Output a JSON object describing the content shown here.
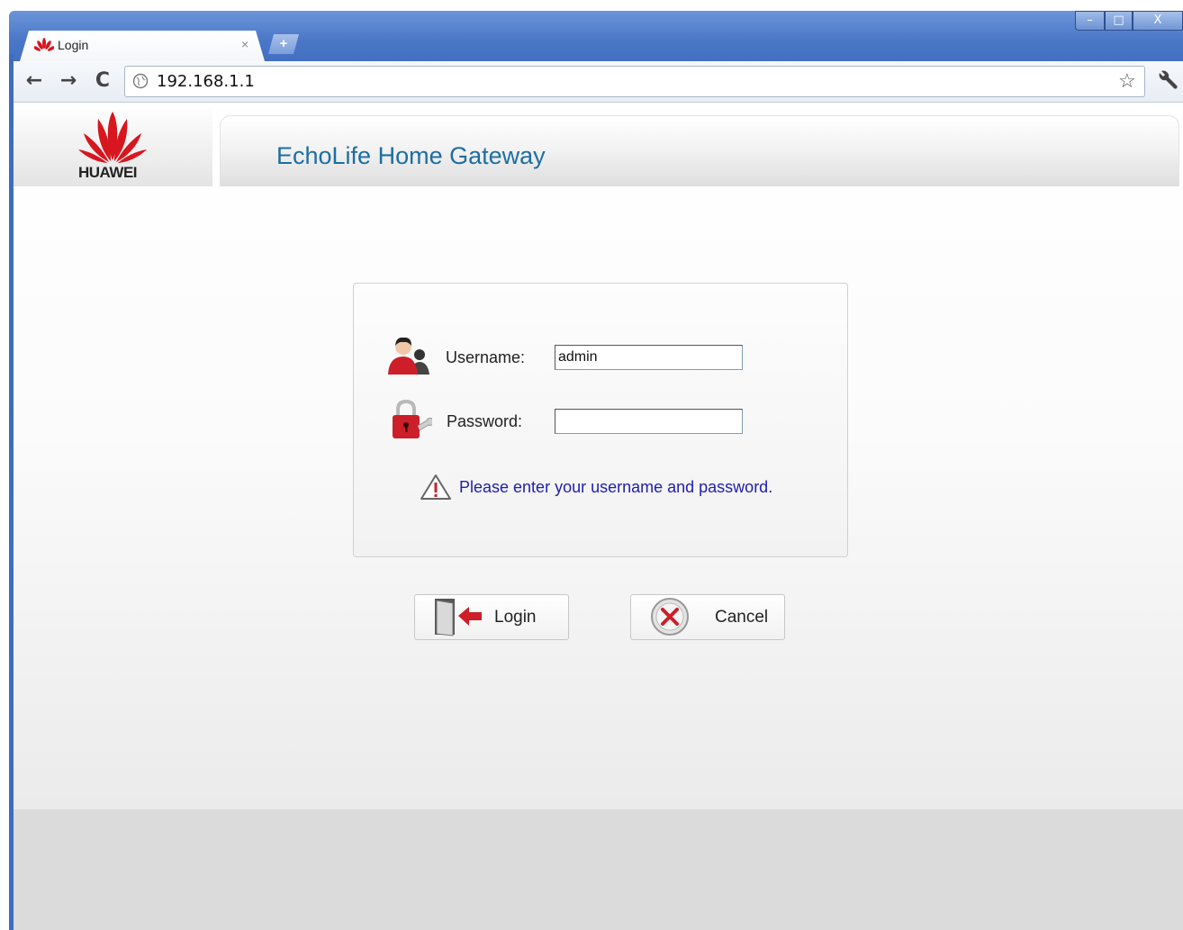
{
  "browser": {
    "tab_title": "Login",
    "tab_close": "×",
    "new_tab": "+",
    "address": "192.168.1.1",
    "back_icon": "back-arrow-icon",
    "forward_icon": "forward-arrow-icon",
    "reload_icon": "reload-icon",
    "star_icon": "bookmark-star-icon",
    "wrench_icon": "wrench-icon",
    "window_controls": {
      "minimize": "–",
      "maximize": "□",
      "close": "X"
    }
  },
  "header": {
    "brand": "HUAWEI",
    "title": "EchoLife Home Gateway"
  },
  "login_form": {
    "username_label": "Username:",
    "username_value": "admin",
    "password_label": "Password:",
    "password_value": "",
    "message": "Please enter your username and password."
  },
  "actions": {
    "login_label": "Login",
    "cancel_label": "Cancel"
  },
  "colors": {
    "title": "#1d6ea0",
    "message": "#2020b0",
    "brand_red": "#d7161f",
    "frame_blue": "#4a76c7"
  }
}
